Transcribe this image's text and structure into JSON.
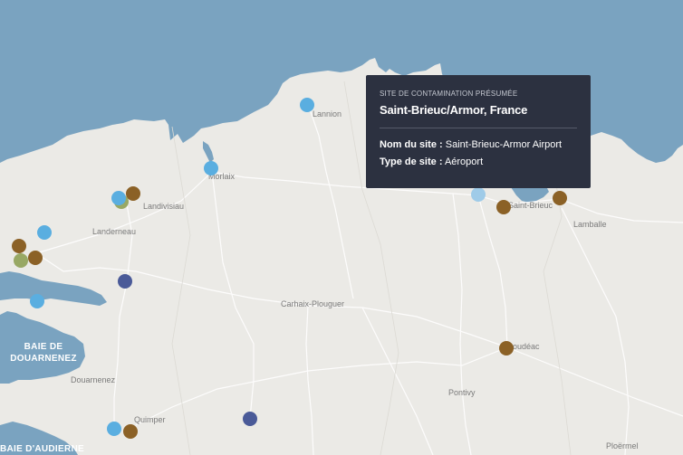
{
  "colors": {
    "sea": "#7aa3c0",
    "land": "#ebeae6",
    "roads": "#ffffff",
    "marker_light_blue": "#5aaee0",
    "marker_pale_blue": "#9fcbe8",
    "marker_brown": "#8b6126",
    "marker_olive": "#98a864",
    "marker_navy": "#4a5a98",
    "tooltip_bg": "#2c3140"
  },
  "towns": [
    "Lannion",
    "Morlaix",
    "Landivisiau",
    "Landerneau",
    "Saint-Brieuc",
    "Lamballe",
    "Carhaix-Plouguer",
    "Loudéac",
    "Douarnenez",
    "Pontivy",
    "Quimper",
    "Ploërmel"
  ],
  "water_labels": [
    "BAIE DE DOUARNENEZ",
    "BAIE D'AUDIERNE"
  ],
  "marker_colors_in_order": [
    "light-blue",
    "light-blue",
    "brown",
    "olive",
    "light-blue",
    "light-blue",
    "brown",
    "olive",
    "brown",
    "light-blue",
    "navy",
    "pale-blue",
    "brown",
    "brown",
    "brown",
    "light-blue",
    "brown",
    "navy"
  ],
  "tooltip": {
    "kicker": "SITE DE CONTAMINATION PRÉSUMÉE",
    "title": "Saint-Brieuc/Armor, France",
    "name_label": "Nom du site :",
    "name_value": "Saint-Brieuc-Armor Airport",
    "type_label": "Type de site :",
    "type_value": "Aéroport"
  }
}
